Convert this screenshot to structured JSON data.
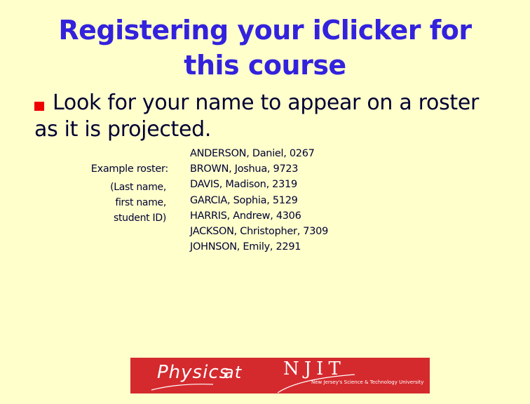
{
  "slide": {
    "title": "Registering your iClicker for this course",
    "title_lines": [
      "Registering your iClicker for",
      "this course"
    ],
    "bullet": {
      "icon": "square-bullet",
      "line1": "Look for your name to appear on a roster",
      "line2": "as it is projected."
    },
    "roster_label": "Example roster:",
    "roster_format": [
      "(Last name,",
      "first name,",
      "student ID)"
    ],
    "roster": [
      "ANDERSON, Daniel, 0267",
      "BROWN, Joshua, 9723",
      "DAVIS, Madison, 2319",
      "GARCIA, Sophia, 5129",
      "HARRIS, Andrew, 4306",
      "JACKSON, Christopher, 7309",
      "JOHNSON, Emily, 2291"
    ]
  },
  "banner": {
    "physics": "Physics",
    "at": "at",
    "njit": "NJIT",
    "tagline": "New Jersey's Science & Technology University"
  },
  "colors": {
    "background": "#ffffcc",
    "title": "#3322dd",
    "body_text": "#000033",
    "bullet": "#ee0000",
    "banner": "#d42a2e"
  }
}
